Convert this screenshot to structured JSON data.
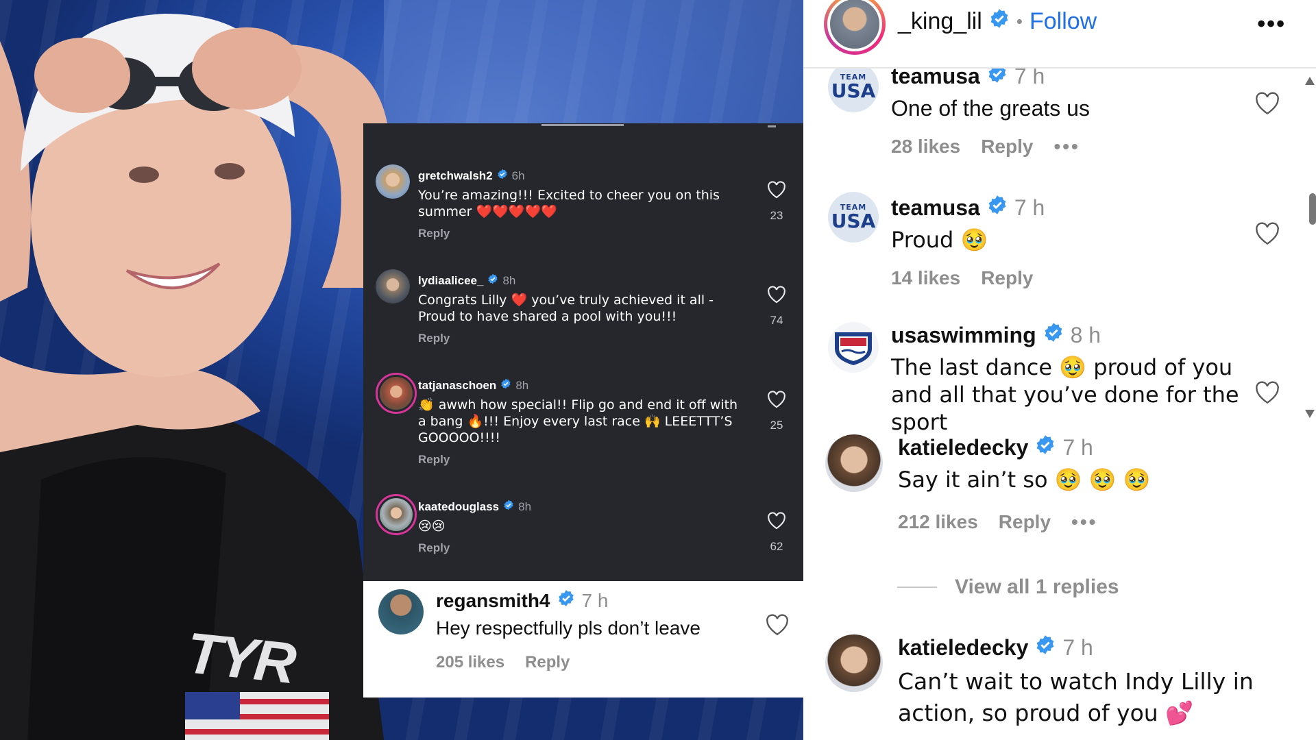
{
  "dark_comments": [
    {
      "username": "gretchwalsh2",
      "time": "6h",
      "text": "You’re amazing!!! Excited to cheer you on this summer ❤️❤️❤️❤️❤️",
      "reply": "Reply",
      "likes": "23"
    },
    {
      "username": "lydiaalicee_",
      "time": "8h",
      "text": "Congrats Lilly ❤️ you’ve truly achieved it all - Proud to have shared a pool with you!!!",
      "reply": "Reply",
      "likes": "74"
    },
    {
      "username": "tatjanaschoen",
      "time": "8h",
      "text": "👏 awwh how special!! Flip go and end it off with a bang 🔥!!! Enjoy every last race 🙌 LEEETTT’S GOOOOO!!!!",
      "reply": "Reply",
      "likes": "25"
    },
    {
      "username": "kaatedouglass",
      "time": "8h",
      "text": "😢😢",
      "reply": "Reply",
      "likes": "62"
    }
  ],
  "white_comment": {
    "username": "regansmith4",
    "time": "7 h",
    "text": "Hey respectfully pls don’t leave",
    "likes": "205 likes",
    "reply": "Reply"
  },
  "header": {
    "username": "_king_lil",
    "dot": "•",
    "follow": "Follow",
    "more": "•••"
  },
  "comments": [
    {
      "username": "teamusa",
      "time": "7 h",
      "text": "One of the greats us",
      "likes": "28 likes",
      "reply": "Reply",
      "more": "•••"
    },
    {
      "username": "teamusa",
      "time": "7 h",
      "text": "Proud 🥹",
      "likes": "14 likes",
      "reply": "Reply"
    },
    {
      "username": "usaswimming",
      "time": "8 h",
      "text": "The last dance 🥹 proud of you and all that you’ve done for the sport"
    },
    {
      "username": "katieledecky",
      "time": "7 h",
      "text": "Say it ain’t so 🥹 🥹 🥹",
      "likes": "212 likes",
      "reply": "Reply",
      "more": "•••"
    },
    {
      "username": "katieledecky",
      "time": "7 h",
      "text": "Can’t wait to watch Indy Lilly in action, so proud of you 💕"
    }
  ],
  "view_replies": "View all 1 replies",
  "avatar_labels": {
    "team": "TEAM",
    "usa": "USA"
  },
  "colors": {
    "verified": "#3897f0",
    "follow": "#1f6fe8",
    "dark_panel": "#25272c"
  }
}
